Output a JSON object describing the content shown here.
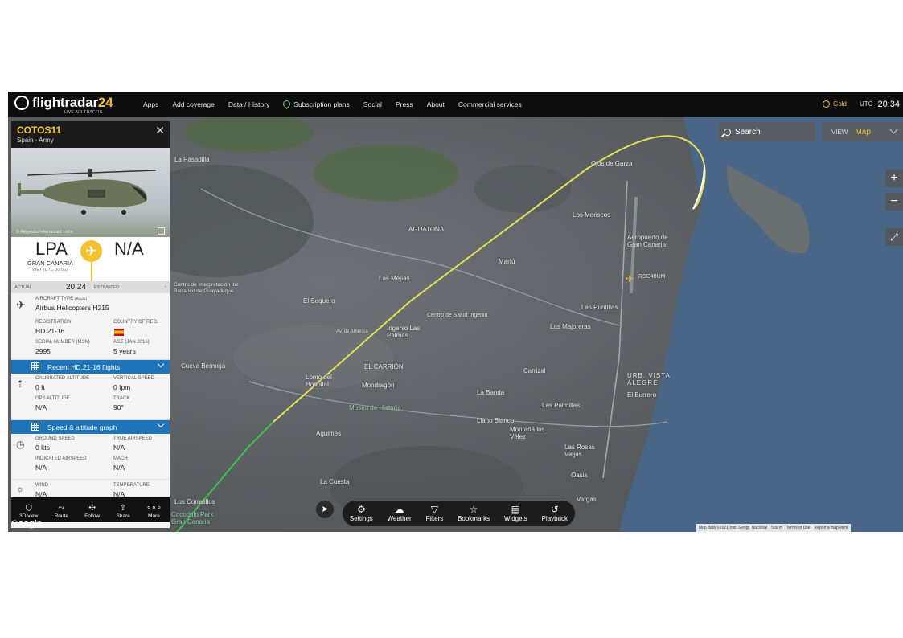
{
  "app": {
    "logo_main": "flightradar",
    "logo_num": "24",
    "logo_sub": "LIVE AIR TRAFFIC"
  },
  "nav": {
    "items": [
      "Apps",
      "Add coverage",
      "Data / History",
      "Subscription plans",
      "Social",
      "Press",
      "About",
      "Commercial services"
    ]
  },
  "account": {
    "tier": "Gold",
    "utc_label": "UTC",
    "time": "20:34"
  },
  "search": {
    "label": "Search"
  },
  "view": {
    "label": "VIEW",
    "value": "Map"
  },
  "flight": {
    "callsign": "COTOS11",
    "operator": "Spain - Army",
    "photo_credit": "© Alejandro Hernández León",
    "origin_code": "LPA",
    "dest_code": "N/A",
    "origin_city": "GRAN CANARIA",
    "origin_tz": "WET (UTC 00:00)",
    "actual_label": "ACTUAL",
    "actual_time": "20:24",
    "estimated_label": "ESTIMATED",
    "estimated_time": "-",
    "aircraft_type_label": "AIRCRAFT TYPE",
    "aircraft_type_code": "(AS32)",
    "aircraft_type": "Airbus Helicopters H215",
    "registration_label": "REGISTRATION",
    "registration": "HD.21-16",
    "country_label": "COUNTRY OF REG.",
    "serial_label": "SERIAL NUMBER (MSN)",
    "serial": "2995",
    "age_label": "AGE (JAN 2016)",
    "age": "5 years",
    "recent_flights_label": "Recent HD.21-16 flights",
    "cal_alt_label": "CALIBRATED ALTITUDE",
    "cal_alt": "0 ft",
    "vspeed_label": "VERTICAL SPEED",
    "vspeed": "0 fpm",
    "gps_alt_label": "GPS ALTITUDE",
    "gps_alt": "N/A",
    "track_label": "TRACK",
    "track": "90°",
    "speed_graph_label": "Speed & altitude graph",
    "gs_label": "GROUND SPEED",
    "gs": "0 kts",
    "tas_label": "TRUE AIRSPEED",
    "tas": "N/A",
    "ias_label": "INDICATED AIRSPEED",
    "ias": "N/A",
    "mach_label": "MACH",
    "mach": "N/A",
    "wind_label": "WIND",
    "wind": "N/A",
    "temp_label": "TEMPERATURE",
    "temp": "N/A"
  },
  "panel_footer": [
    "3D view",
    "Route",
    "Follow",
    "Share",
    "More"
  ],
  "toolbar": [
    "Settings",
    "Weather",
    "Filters",
    "Bookmarks",
    "Widgets",
    "Playback"
  ],
  "map_labels": {
    "ojos_de_garza": "Ojos de Garza",
    "los_moriscos": "Los Moriscos",
    "airport": "Aeropuerto de Gran Canaria",
    "agua_tona": "AGUATONA",
    "marfu": "Marfú",
    "las_mejias": "Las Mejías",
    "el_sequero": "El Sequero",
    "las_puntillas": "Las Puntillas",
    "las_majoreras": "Las Majoreras",
    "ingenio": "Ingenio Las Palmas",
    "el_carrion": "EL CARRIÓN",
    "carrizal": "Carrizal",
    "cueva_bermeja": "Cueva Bermeja",
    "lomo_hospital": "Lomo del Hospital",
    "mondragon": "Mondragón",
    "museo": "Museo de Historia",
    "urb_vista": "URB. VISTA ALEGRE",
    "el_burrero": "El Burrero",
    "la_banda": "La Banda",
    "las_palmillas": "Las Palmillas",
    "aguimes": "Agüimes",
    "llano_blanco": "Llano Blanco",
    "montana": "Montaña los Vélez",
    "las_rosas": "Las Rosas Viejas",
    "la_pasadilla": "La Pasadilla",
    "oasis": "Oasis",
    "vargas": "Vargas",
    "la_cuesta": "La Cuesta",
    "los_corralillos": "Los Corralillos",
    "cocodrilo": "Cocodrilo Park Gran Canaria",
    "centro_interp": "Centro de Interpretación del Barranco de Guayadeque",
    "centro_salud": "Centro de Salud Ingenio",
    "av_america": "Av. de América",
    "other_aircraft": "RSC40UM"
  },
  "attribution": {
    "data": "Map data ©2021 Inst. Geogr. Nacional",
    "scale": "500 m",
    "terms": "Terms of Use",
    "report": "Report a map error"
  },
  "colors": {
    "accent": "#f2c233",
    "panel_blue": "#1e74b8",
    "track_yellow": "#e6e255",
    "track_green": "#3cc24a"
  }
}
